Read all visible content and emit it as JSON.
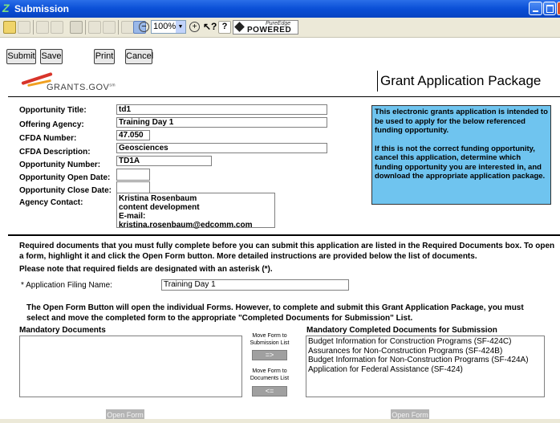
{
  "window": {
    "title": "Submission"
  },
  "toolbar": {
    "zoom": "100%",
    "brand_small": "PureEdge",
    "brand_big": "POWERED"
  },
  "actions": {
    "submit": "Submit",
    "save": "Save",
    "print": "Print",
    "cancel": "Cancel"
  },
  "header": {
    "logo_text": "GRANTS.GOV",
    "logo_tm": "sm",
    "page_title": "Grant Application Package"
  },
  "info": {
    "opportunity_title": {
      "label": "Opportunity Title:",
      "value": "td1"
    },
    "offering_agency": {
      "label": "Offering Agency:",
      "value": "Training Day 1"
    },
    "cfda_number": {
      "label": "CFDA Number:",
      "value": "47.050"
    },
    "cfda_description": {
      "label": "CFDA Description:",
      "value": "Geosciences"
    },
    "opportunity_number": {
      "label": "Opportunity Number:",
      "value": "TD1A"
    },
    "open_date": {
      "label": "Opportunity Open Date:",
      "value": ""
    },
    "close_date": {
      "label": "Opportunity Close Date:",
      "value": ""
    },
    "agency_contact": {
      "label": "Agency Contact:",
      "lines": [
        "Kristina Rosenbaum",
        "content development",
        "E-mail: kristina.rosenbaum@edcomm.com"
      ]
    }
  },
  "notice": {
    "p1": "This electronic grants application is intended to be used to apply for the below referenced funding opportunity.",
    "p2": "If this is not the correct funding opportunity, cancel this application, determine which funding opportunity you are interested in, and download the appropriate application package."
  },
  "instructions": {
    "p1": "Required documents that you must fully complete before you can submit this application are listed in the Required Documents box.  To open a form, highlight it and click the Open Form button.  More detailed instructions are provided below the list of documents.",
    "p2": "Please note that required fields are designated with an asterisk (*).",
    "p3": "The Open Form Button will open the individual Forms.  However, to complete and submit this Grant Application Package, you must select and move the completed form to the appropriate \"Completed Documents for Submission\" List."
  },
  "filing": {
    "label": "* Application Filing Name:",
    "value": "Training Day 1"
  },
  "lists": {
    "mandatory_header": "Mandatory Documents",
    "completed_header": "Mandatory Completed Documents for Submission",
    "completed_items": [
      "Budget Information for Construction Programs (SF-424C)",
      "Assurances for Non-Construction Programs (SF-424B)",
      "Budget Information for Non-Construction Programs (SF-424A)",
      "Application for Federal Assistance (SF-424)"
    ]
  },
  "move": {
    "to_submission_label": "Move Form to Submission List",
    "to_submission_button": "=>",
    "to_documents_label": "Move Form to Documents List",
    "to_documents_button": "<="
  },
  "open_form": {
    "left": "Open Form",
    "right": "Open Form"
  },
  "colors": {
    "titlebar": "#0a4fd6",
    "notice_bg": "#6fc4ef",
    "toolbar_bg": "#ece9d8"
  }
}
